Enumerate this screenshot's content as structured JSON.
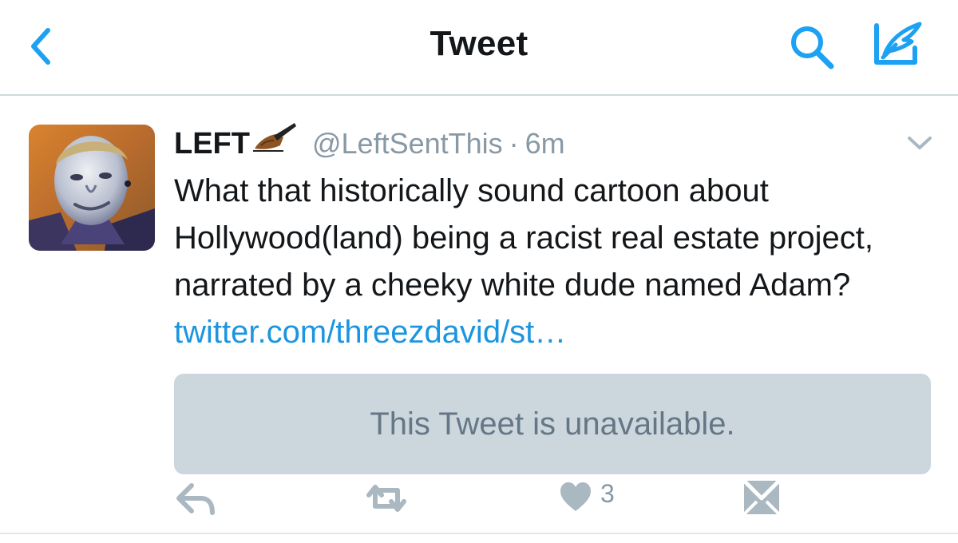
{
  "navbar": {
    "title": "Tweet",
    "back_icon": "chevron-left-icon",
    "search_icon": "search-icon",
    "compose_icon": "compose-tweet-icon",
    "accent_color": "#1da1f2"
  },
  "tweet": {
    "display_name": "LEFT",
    "name_emoji": "writing-hand-emoji",
    "handle": "@LeftSentThis",
    "separator": "·",
    "time": "6m",
    "text": "What that historically sound cartoon about Hollywood(land) being a racist real estate project, narrated by a cheeky white dude named Adam? ",
    "link": "twitter.com/threezdavid/st…",
    "quoted_status": "This Tweet is unavailable.",
    "like_count": "3",
    "link_color": "#1b95e0"
  }
}
